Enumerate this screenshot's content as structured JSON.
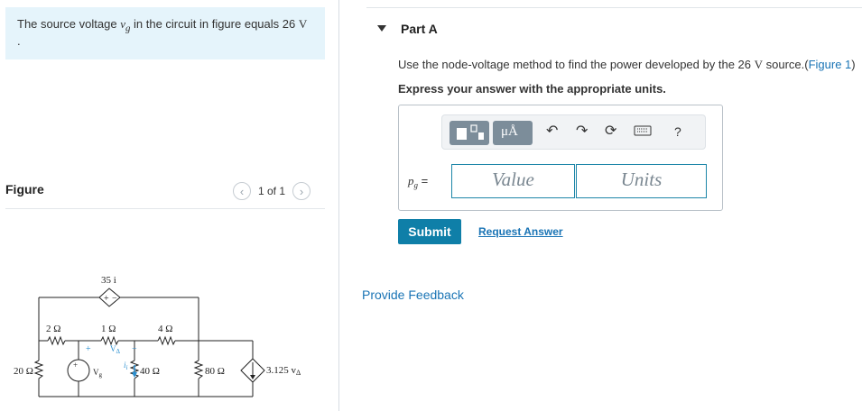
{
  "intro": {
    "text_before": "The source voltage ",
    "var_base": "v",
    "var_sub": "g",
    "text_after": " in the circuit in figure equals 26 ",
    "unit": "V",
    "dot": "."
  },
  "figure": {
    "label": "Figure",
    "pager": "1 of 1"
  },
  "circuit": {
    "labels": {
      "dep_source_top": "35 i",
      "dep_source_top_sub": "i",
      "r2": "2 Ω",
      "r1": "1 Ω",
      "r4": "4 Ω",
      "r20": "20 Ω",
      "r40": "40 Ω",
      "r80": "80 Ω",
      "vdelta": "V",
      "vdelta_sub": "Δ",
      "vg": "V",
      "vg_sub": "g",
      "ii": "i",
      "ii_sub": "i",
      "current_source": "3.125 v",
      "current_source_sub": "Δ",
      "plus": "+",
      "minus": "−"
    }
  },
  "part": {
    "title": "Part A",
    "question_before": "Use the node-voltage method to find the power developed by the 26 ",
    "question_unit": "V",
    "question_after": " source.(",
    "figure_link": "Figure 1",
    "question_close": ")",
    "instruction": "Express your answer with the appropriate units."
  },
  "answer": {
    "label_base": "p",
    "label_sub": "g",
    "label_eq": " =",
    "value_placeholder": "Value",
    "units_placeholder": "Units",
    "toolbar": {
      "units_glyph": "μÅ",
      "help": "?"
    }
  },
  "actions": {
    "submit": "Submit",
    "request_answer": "Request Answer",
    "provide_feedback": "Provide Feedback"
  },
  "colors": {
    "intro_bg": "#e5f4fb",
    "link": "#1a74b5",
    "submit_bg": "#0f7fa8",
    "input_border": "#1d86a8",
    "toolbar_dark": "#7c8d9a"
  }
}
